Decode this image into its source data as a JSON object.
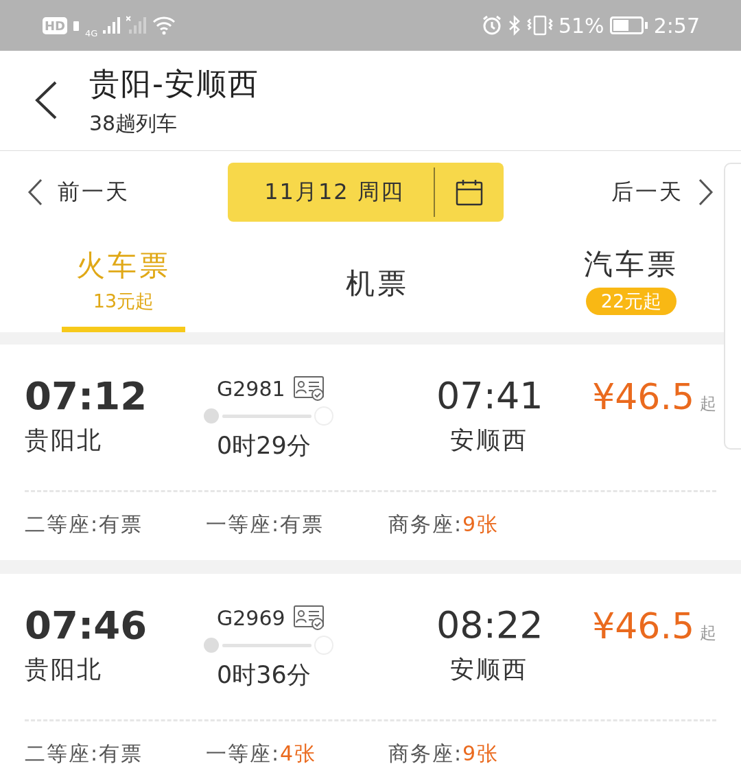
{
  "status_bar": {
    "hd": "HD",
    "network": "4G",
    "battery": "51%",
    "time": "2:57"
  },
  "header": {
    "title": "贵阳-安顺西",
    "subtitle": "38趟列车"
  },
  "date_bar": {
    "prev": "前一天",
    "date": "11月12 周四",
    "next": "后一天"
  },
  "tabs": [
    {
      "label": "火车票",
      "price": "13元起",
      "kind": "plain",
      "selected": true
    },
    {
      "label": "机票",
      "kind": "none",
      "selected": false
    },
    {
      "label": "汽车票",
      "price": "22元起",
      "kind": "badge",
      "selected": false
    }
  ],
  "trains": [
    {
      "depart_time": "07:12",
      "depart_station": "贵阳北",
      "number": "G2981",
      "duration": "0时29分",
      "arrive_time": "07:41",
      "arrive_station": "安顺西",
      "price": "¥46.5",
      "price_suffix": "起",
      "seats": [
        {
          "label": "二等座:",
          "availability": "有票",
          "limited": false
        },
        {
          "label": "一等座:",
          "availability": "有票",
          "limited": false
        },
        {
          "label": "商务座:",
          "availability": "9张",
          "limited": true
        }
      ]
    },
    {
      "depart_time": "07:46",
      "depart_station": "贵阳北",
      "number": "G2969",
      "duration": "0时36分",
      "arrive_time": "08:22",
      "arrive_station": "安顺西",
      "price": "¥46.5",
      "price_suffix": "起",
      "seats": [
        {
          "label": "二等座:",
          "availability": "有票",
          "limited": false
        },
        {
          "label": "一等座:",
          "availability": "4张",
          "limited": true
        },
        {
          "label": "商务座:",
          "availability": "9张",
          "limited": true
        }
      ]
    }
  ]
}
